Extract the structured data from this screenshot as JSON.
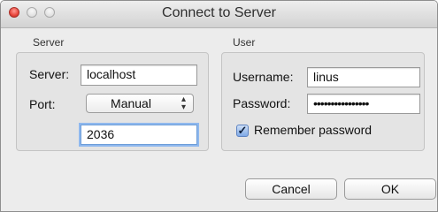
{
  "window": {
    "title": "Connect to Server"
  },
  "server_group": {
    "title": "Server",
    "server_label": "Server:",
    "server_value": "localhost",
    "port_label": "Port:",
    "port_mode": "Manual",
    "port_value": "2036"
  },
  "user_group": {
    "title": "User",
    "username_label": "Username:",
    "username_value": "linus",
    "password_label": "Password:",
    "password_value": "••••••••••••••••",
    "remember_label": "Remember password",
    "remember_checked": true
  },
  "buttons": {
    "cancel": "Cancel",
    "ok": "OK"
  },
  "icons": {
    "close": "close-icon",
    "minimize": "minimize-icon",
    "zoom": "zoom-icon",
    "checkbox": "checkmark-icon",
    "popup": "updown-arrows-icon"
  },
  "colors": {
    "focus_ring": "#8fb8ee",
    "close_button": "#e8463c",
    "checkbox_fill": "#7fa9e6"
  }
}
